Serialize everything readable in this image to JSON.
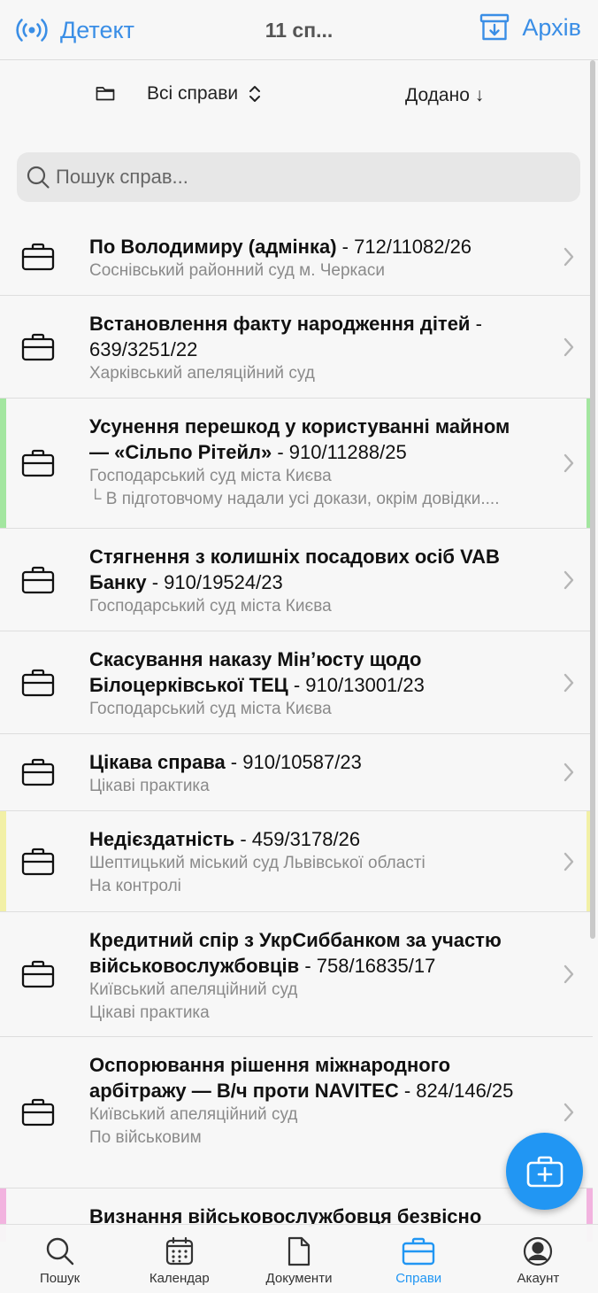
{
  "header": {
    "left_label": "Детект",
    "left_icon": "broadcast-icon",
    "title": "11 сп...",
    "right_label": "Архів",
    "right_icon": "archive-icon",
    "accent": "#3a8ee6"
  },
  "filter": {
    "folder_icon": "folder-icon",
    "scope_label": "Всі справи",
    "sort_label": "Додано ↓"
  },
  "search": {
    "placeholder": "Пошук справ..."
  },
  "cases": [
    {
      "title": "По Володимиру (адмінка)",
      "number": " - 712/11082/26",
      "subs": [
        "Соснівський районний суд м. Черкаси"
      ],
      "marker": ""
    },
    {
      "title": "Встановлення факту народження дітей",
      "number": " - 639/3251/22",
      "subs": [
        "Харківський апеляційний суд"
      ],
      "marker": ""
    },
    {
      "title": "Усунення перешкод у користуванні майном — «Сільпо Рітейл»",
      "number": " - 910/11288/25",
      "subs": [
        "Господарський суд міста Києва",
        "└ В підготовчому надали усі докази, окрім довідки...."
      ],
      "marker": "#a3e6a0"
    },
    {
      "title": "Стягнення з колишніх посадових осіб VAB Банку",
      "number": " - 910/19524/23",
      "subs": [
        "Господарський суд міста Києва"
      ],
      "marker": ""
    },
    {
      "title": "Скасування наказу Мін’юсту щодо Білоцерківської ТЕЦ",
      "number": " - 910/13001/23",
      "subs": [
        "Господарський суд міста Києва"
      ],
      "marker": ""
    },
    {
      "title": "Цікава справа",
      "number": " - 910/10587/23",
      "subs": [
        "Цікаві практика"
      ],
      "marker": ""
    },
    {
      "title": "Недієздатність",
      "number": " - 459/3178/26",
      "subs": [
        "Шептицький міський суд Львівської області",
        "На контролі"
      ],
      "marker": "#f2f0a6"
    },
    {
      "title": "Кредитний спір з УкрСиббанком за участю військовослужбовців",
      "number": " - 758/16835/17",
      "subs": [
        "Київський апеляційний суд",
        "Цікаві практика"
      ],
      "marker": ""
    },
    {
      "title": "Оспорювання рішення міжнародного арбітражу — В/ч проти NAVITEC",
      "number": " - 824/146/25",
      "subs": [
        "Київський апеляційний суд",
        "По військовим"
      ],
      "marker": ""
    },
    {
      "title": "Визнання військовослужбовця безвісно",
      "number": "",
      "subs": [],
      "marker": "#f2b3df"
    }
  ],
  "fab": {
    "icon": "add-case-icon",
    "color": "#2196f3"
  },
  "tabs": [
    {
      "label": "Пошук",
      "icon": "search-icon",
      "active": false
    },
    {
      "label": "Календар",
      "icon": "calendar-icon",
      "active": false
    },
    {
      "label": "Документи",
      "icon": "document-icon",
      "active": false
    },
    {
      "label": "Справи",
      "icon": "briefcase-icon",
      "active": true
    },
    {
      "label": "Акаунт",
      "icon": "account-icon",
      "active": false
    }
  ]
}
